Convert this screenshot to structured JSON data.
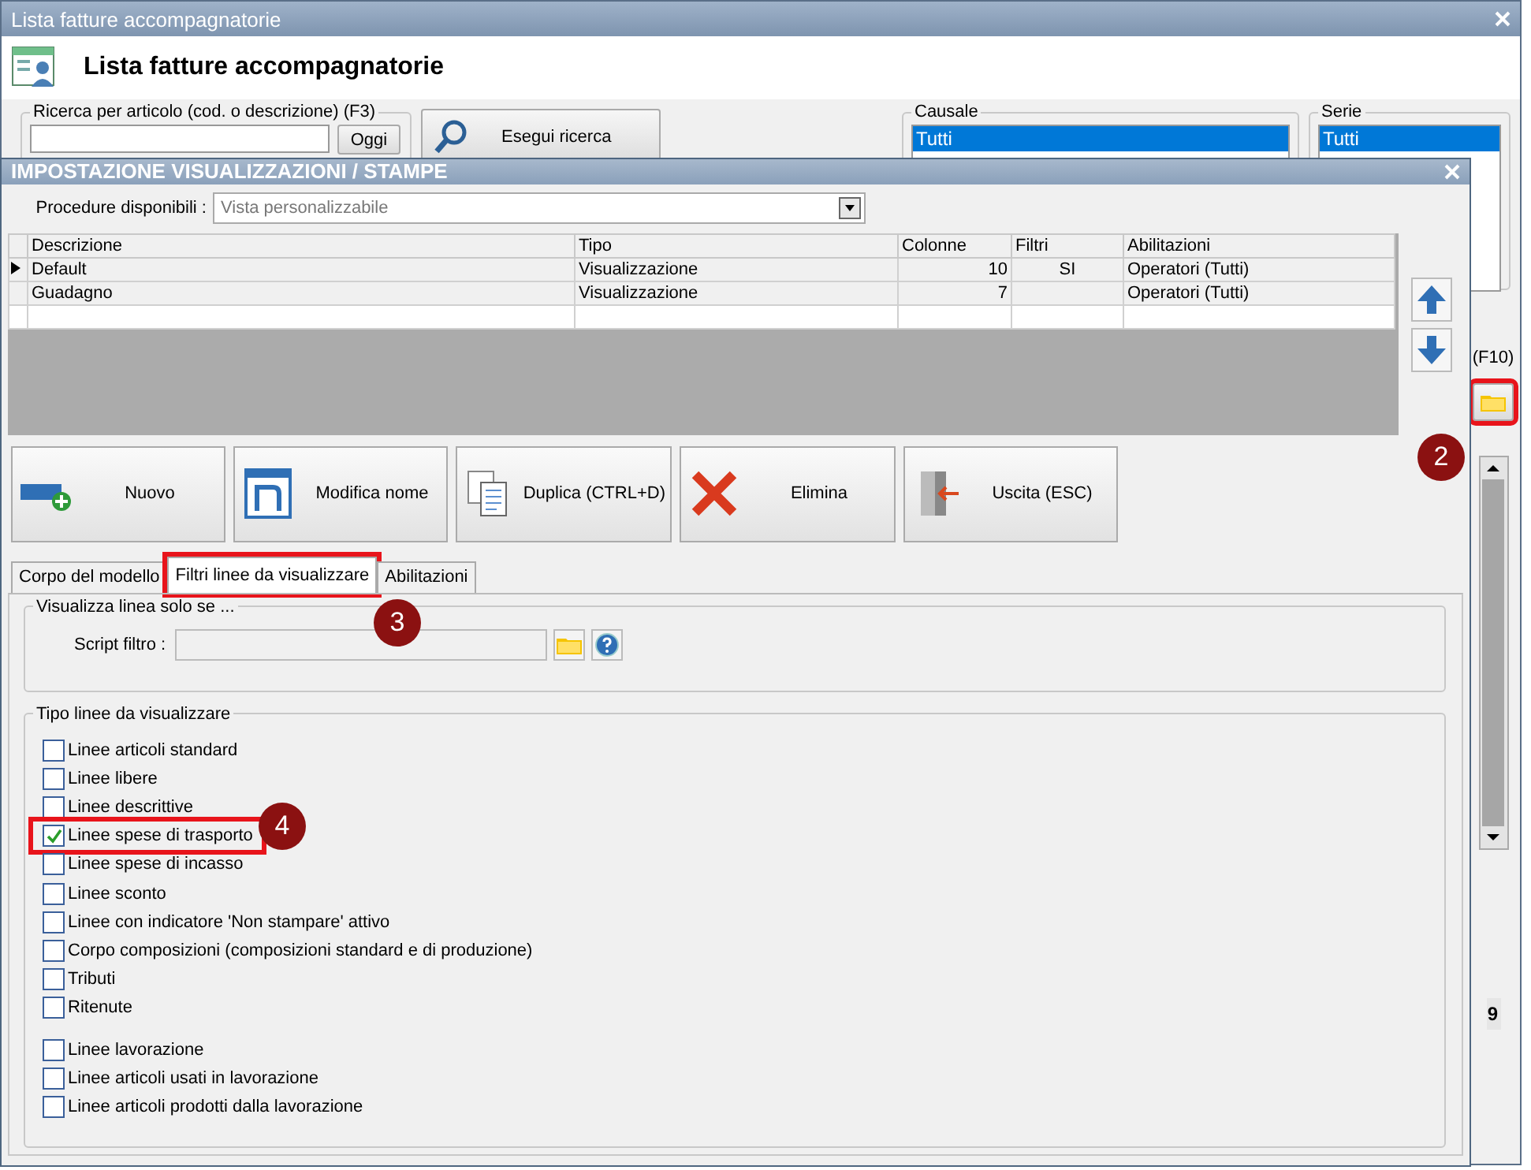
{
  "main_window": {
    "title": "Lista fatture accompagnatorie",
    "heading": "Lista fatture accompagnatorie",
    "search": {
      "legend": "Ricerca per articolo (cod. o descrizione) (F3)",
      "today_button": "Oggi"
    },
    "search_button": "Esegui ricerca",
    "causale": {
      "legend": "Causale",
      "items": [
        {
          "label": "Tutti",
          "selected": true
        }
      ]
    },
    "serie": {
      "legend": "Serie",
      "items": [
        {
          "label": "Tutti",
          "selected": true
        }
      ]
    },
    "shortcut": "(F10)",
    "folder_button": {
      "highlighted": true
    },
    "status_value": "9"
  },
  "dialog": {
    "title": "IMPOSTAZIONE VISUALIZZAZIONI / STAMPE",
    "procedure": {
      "label": "Procedure disponibili :",
      "value": "Vista personalizzabile"
    },
    "table": {
      "columns": [
        "Descrizione",
        "Tipo",
        "Colonne",
        "Filtri",
        "Abilitazioni"
      ],
      "rows": [
        {
          "current": true,
          "cells": [
            "Default",
            "Visualizzazione",
            "10",
            "SI",
            "Operatori (Tutti)"
          ]
        },
        {
          "current": false,
          "cells": [
            "Guadagno",
            "Visualizzazione",
            "7",
            "",
            "Operatori (Tutti)"
          ]
        }
      ]
    },
    "buttons": [
      {
        "kind": "new",
        "label": "Nuovo"
      },
      {
        "kind": "rename",
        "label": "Modifica nome"
      },
      {
        "kind": "duplicate",
        "label": "Duplica (CTRL+D)"
      },
      {
        "kind": "delete",
        "label": "Elimina"
      },
      {
        "kind": "exit",
        "label": "Uscita (ESC)"
      }
    ],
    "tabs": [
      {
        "label": "Corpo del modello",
        "selected": false,
        "highlighted": false
      },
      {
        "label": "Filtri linee da visualizzare",
        "selected": true,
        "highlighted": true
      },
      {
        "label": "Abilitazioni",
        "selected": false,
        "highlighted": false
      }
    ],
    "script_group": {
      "legend": "Visualizza linea solo se ...",
      "label": "Script filtro :"
    },
    "lines_group": {
      "legend": "Tipo linee da visualizzare",
      "groups": [
        [
          {
            "label": "Linee articoli standard",
            "checked": false,
            "highlighted": false
          },
          {
            "label": "Linee libere",
            "checked": false,
            "highlighted": false
          },
          {
            "label": "Linee descrittive",
            "checked": false,
            "highlighted": false
          },
          {
            "label": "Linee spese di trasporto",
            "checked": true,
            "highlighted": true
          },
          {
            "label": "Linee spese di incasso",
            "checked": false,
            "highlighted": false
          },
          {
            "label": "Linee sconto",
            "checked": false,
            "highlighted": false
          },
          {
            "label": "Linee con indicatore 'Non stampare' attivo",
            "checked": false,
            "highlighted": false
          },
          {
            "label": "Corpo composizioni (composizioni standard e di produzione)",
            "checked": false,
            "highlighted": false
          },
          {
            "label": "Tributi",
            "checked": false,
            "highlighted": false
          },
          {
            "label": "Ritenute",
            "checked": false,
            "highlighted": false
          }
        ],
        [
          {
            "label": "Linee lavorazione",
            "checked": false,
            "highlighted": false
          },
          {
            "label": "Linee articoli usati in lavorazione",
            "checked": false,
            "highlighted": false
          },
          {
            "label": "Linee articoli prodotti dalla lavorazione",
            "checked": false,
            "highlighted": false
          }
        ]
      ]
    }
  },
  "annotations": [
    {
      "number": "2"
    },
    {
      "number": "3"
    },
    {
      "number": "4"
    }
  ]
}
